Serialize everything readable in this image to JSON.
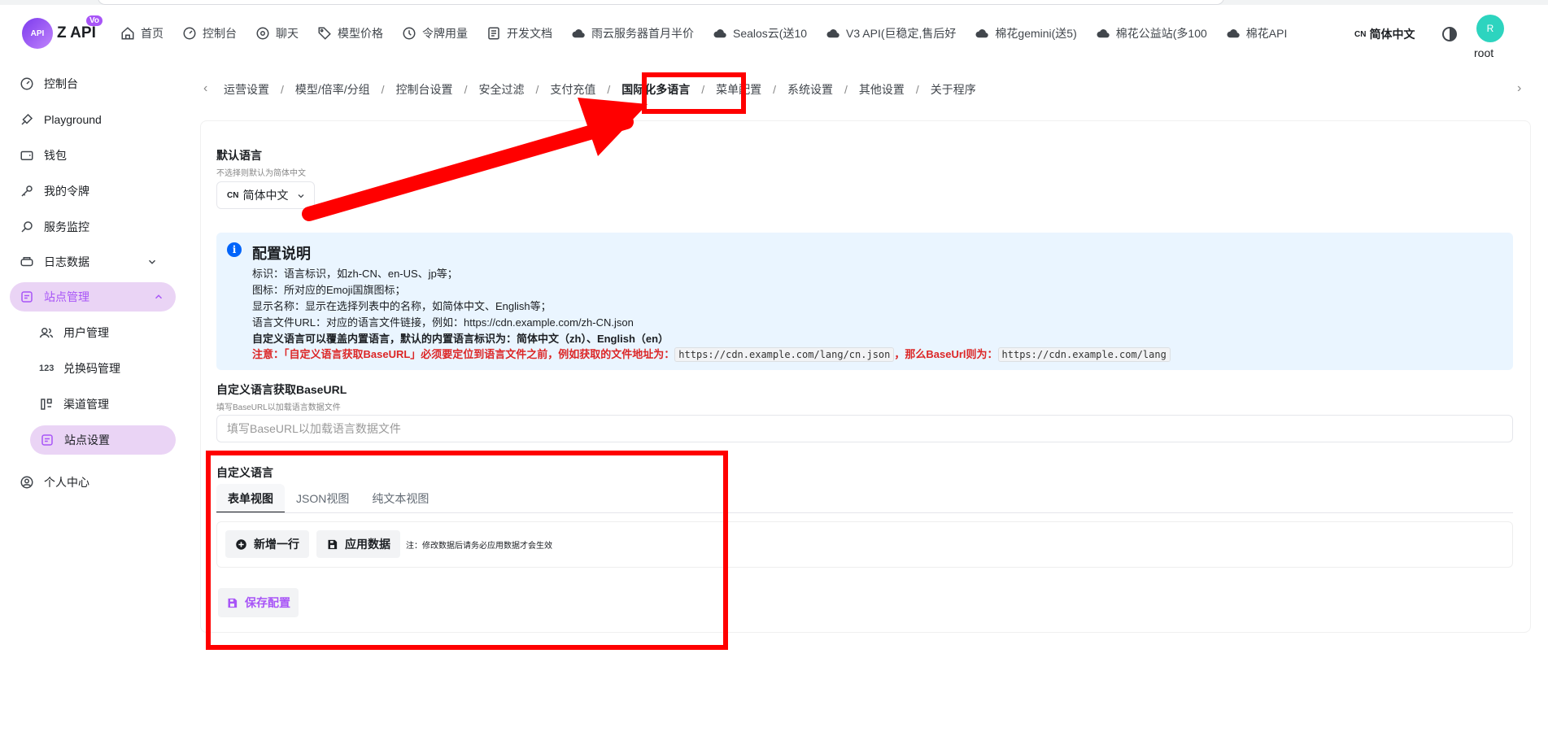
{
  "header": {
    "brand": "Z API",
    "logo_text": "API",
    "logo_badge": "Vo",
    "nav": [
      {
        "label": "首页",
        "icon": "home-icon"
      },
      {
        "label": "控制台",
        "icon": "dashboard-icon"
      },
      {
        "label": "聊天",
        "icon": "chat-icon"
      },
      {
        "label": "模型价格",
        "icon": "tag-icon"
      },
      {
        "label": "令牌用量",
        "icon": "clock-icon"
      },
      {
        "label": "开发文档",
        "icon": "document-icon"
      },
      {
        "label": "雨云服务器首月半价",
        "icon": "cloud-icon"
      },
      {
        "label": "Sealos云(送10",
        "icon": "cloud-icon"
      },
      {
        "label": "V3 API(巨稳定,售后好",
        "icon": "cloud-icon"
      },
      {
        "label": "棉花gemini(送5)",
        "icon": "cloud-icon"
      },
      {
        "label": "棉花公益站(多100",
        "icon": "cloud-icon"
      },
      {
        "label": "棉花API",
        "icon": "cloud-icon"
      }
    ],
    "lang_code": "CN",
    "lang_label": "简体中文",
    "avatar_letter": "R",
    "username": "root"
  },
  "sidebar": {
    "items": [
      {
        "label": "控制台",
        "icon": "dashboard-icon"
      },
      {
        "label": "Playground",
        "icon": "brush-icon"
      },
      {
        "label": "钱包",
        "icon": "wallet-icon"
      },
      {
        "label": "我的令牌",
        "icon": "key-icon"
      },
      {
        "label": "服务监控",
        "icon": "monitor-icon"
      },
      {
        "label": "日志数据",
        "icon": "log-icon"
      },
      {
        "label": "站点管理",
        "icon": "site-icon"
      },
      {
        "label": "用户管理",
        "icon": "users-icon"
      },
      {
        "label": "兑换码管理",
        "icon": "code-icon"
      },
      {
        "label": "渠道管理",
        "icon": "channel-icon"
      },
      {
        "label": "站点设置",
        "icon": "settings-icon"
      },
      {
        "label": "个人中心",
        "icon": "user-icon"
      }
    ],
    "code_icon_text": "123"
  },
  "settings_tabs": [
    "运营设置",
    "模型/倍率/分组",
    "控制台设置",
    "安全过滤",
    "支付充值",
    "国际化多语言",
    "菜单配置",
    "系统设置",
    "其他设置",
    "关于程序"
  ],
  "form": {
    "default_lang_label": "默认语言",
    "default_lang_hint": "不选择则默认为简体中文",
    "default_lang_code": "CN",
    "default_lang_value": "简体中文",
    "info_title": "配置说明",
    "info_lines": [
      "标识：语言标识，如zh-CN、en-US、jp等；",
      "图标：所对应的Emoji国旗图标；",
      "显示名称：显示在选择列表中的名称，如简体中文、English等；",
      "语言文件URL：对应的语言文件链接，例如：https://cdn.example.com/zh-CN.json",
      "自定义语言可以覆盖内置语言，默认的内置语言标识为：简体中文（zh）、English（en）"
    ],
    "warn_prefix": "注意：「自定义语言获取BaseURL」必须要定位到语言文件之前，例如获取的文件地址为：",
    "warn_code1": "https://cdn.example.com/lang/cn.json",
    "warn_mid": "，那么BaseUrl则为：",
    "warn_code2": "https://cdn.example.com/lang",
    "baseurl_label": "自定义语言获取BaseURL",
    "baseurl_hint": "填写BaseURL以加载语言数据文件",
    "baseurl_placeholder": "填写BaseURL以加载语言数据文件",
    "custom_lang_label": "自定义语言",
    "view_tabs": [
      "表单视图",
      "JSON视图",
      "纯文本视图"
    ],
    "add_row": "新增一行",
    "apply_data": "应用数据",
    "note": "注：修改数据后请务必应用数据才会生效",
    "save": "保存配置"
  },
  "colors": {
    "accent": "#a855f7",
    "annotation": "#ff0000",
    "info_bg": "#eaf5ff",
    "warning": "#dc2626"
  }
}
